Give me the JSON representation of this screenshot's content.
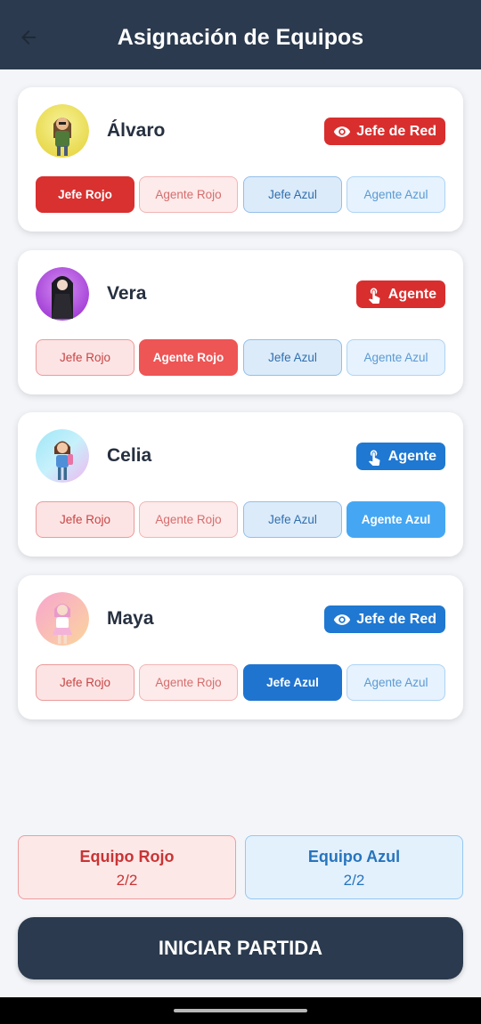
{
  "header": {
    "title": "Asignación de Equipos"
  },
  "options": {
    "jefe_rojo": "Jefe Rojo",
    "agente_rojo": "Agente Rojo",
    "jefe_azul": "Jefe Azul",
    "agente_azul": "Agente Azul"
  },
  "players": [
    {
      "name": "Álvaro",
      "role": "Jefe de Red",
      "role_icon": "eye-icon",
      "role_color": "#d92e2e",
      "selected": "Jefe Rojo"
    },
    {
      "name": "Vera",
      "role": "Agente",
      "role_icon": "tap-icon",
      "role_color": "#d92e2e",
      "selected": "Agente Rojo"
    },
    {
      "name": "Celia",
      "role": "Agente",
      "role_icon": "tap-icon",
      "role_color": "#1f78d1",
      "selected": "Agente Azul"
    },
    {
      "name": "Maya",
      "role": "Jefe de Red",
      "role_icon": "eye-icon",
      "role_color": "#1f78d1",
      "selected": "Jefe Azul"
    }
  ],
  "teams": {
    "red": {
      "name": "Equipo Rojo",
      "count": "2/2"
    },
    "blue": {
      "name": "Equipo Azul",
      "count": "2/2"
    }
  },
  "start_button": {
    "label": "INICIAR PARTIDA"
  }
}
